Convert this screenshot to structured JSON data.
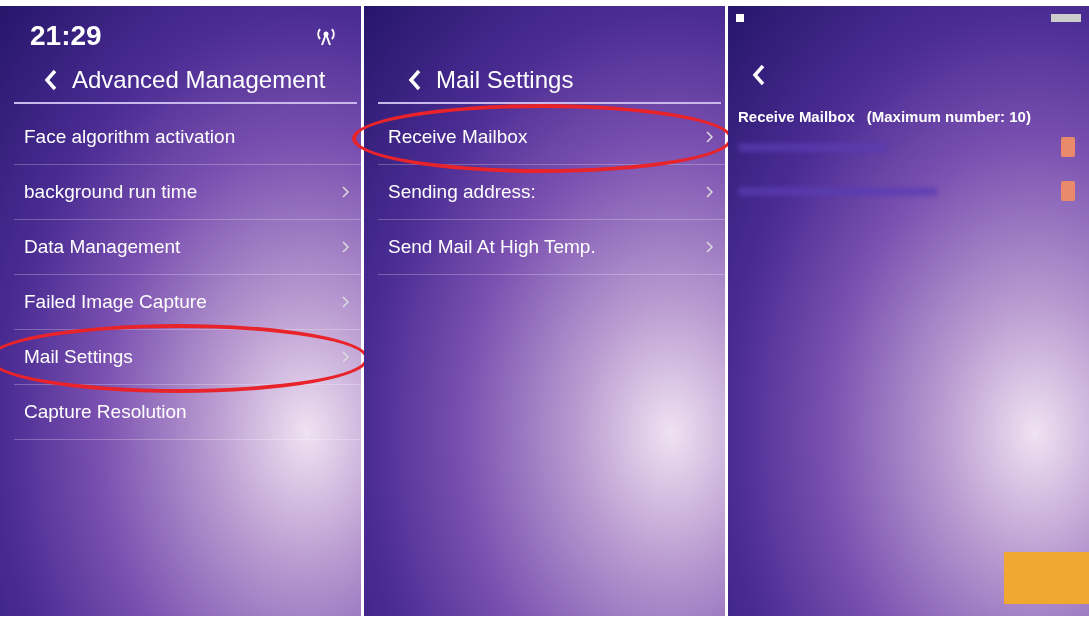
{
  "screens": [
    {
      "kind": "menu",
      "time": "21:29",
      "title": "Advanced Management",
      "items": [
        {
          "label": "Face algorithm activation",
          "chevron": false,
          "circled": false
        },
        {
          "label": "background run time",
          "chevron": true,
          "circled": false
        },
        {
          "label": "Data Management",
          "chevron": true,
          "circled": false
        },
        {
          "label": "Failed Image Capture",
          "chevron": true,
          "circled": false
        },
        {
          "label": "Mail Settings",
          "chevron": true,
          "circled": true
        },
        {
          "label": "Capture Resolution",
          "chevron": false,
          "circled": false
        }
      ]
    },
    {
      "kind": "menu",
      "title": "Mail Settings",
      "items": [
        {
          "label": "Receive Mailbox",
          "chevron": true,
          "circled": true
        },
        {
          "label": "Sending address:",
          "chevron": true,
          "circled": false
        },
        {
          "label": "Send Mail At High Temp.",
          "chevron": true,
          "circled": false
        }
      ]
    },
    {
      "kind": "mailbox",
      "heading": "Receive Mailbox",
      "note": "(Maximum number: 10)"
    }
  ]
}
